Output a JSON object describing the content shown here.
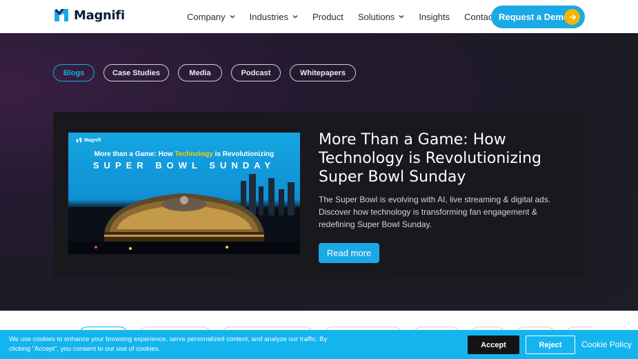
{
  "header": {
    "brand": "Magnifi",
    "nav": [
      {
        "label": "Company",
        "icon": "chevron-down-icon"
      },
      {
        "label": "Industries",
        "icon": "chevron-down-icon"
      },
      {
        "label": "Product"
      },
      {
        "label": "Solutions",
        "icon": "chevron-down-icon"
      },
      {
        "label": "Insights"
      },
      {
        "label": "Contact"
      }
    ],
    "cta": "Request a Demo",
    "cta_icon": "arrow-right-icon"
  },
  "filters": {
    "items": [
      "Blogs",
      "Case Studies",
      "Media",
      "Podcast",
      "Whitepapers"
    ],
    "active": "Blogs"
  },
  "featured": {
    "image": {
      "brand": "Magnifi",
      "line1_pre": "More than a Game: How ",
      "line1_highlight": "Technology",
      "line1_post": " is Revolutionizing",
      "line2": "SUPER BOWL SUNDAY"
    },
    "title": "More Than a Game: How Technology is Revolutionizing Super Bowl Sunday",
    "description": "The Super Bowl is evolving with AI, live streaming & digital ads. Discover how technology is transforming fan engagement & redefining Super Bowl Sunday.",
    "button": "Read more"
  },
  "cookie": {
    "text": "We use cookies to enhance your browsing experience, serve personalized content, and analyze our traffic. By clicking \"Accept\", you consent to our use of cookies.",
    "accept": "Accept",
    "reject": "Reject",
    "policy": "Cookie Policy"
  },
  "colors": {
    "accent": "#1aa9e6",
    "cta_arrow": "#f5b400",
    "hero_bg": "#1c1d26",
    "cookie_bg": "#14b4ef"
  }
}
